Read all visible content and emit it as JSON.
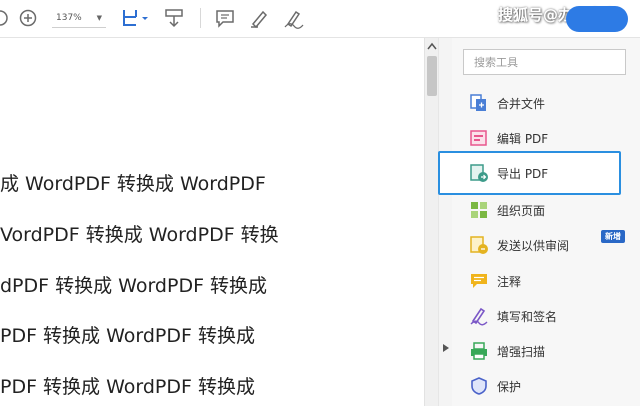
{
  "toolbar": {
    "zoom_value": "137%",
    "icons": [
      "zoom-in-icon",
      "fit-page-icon",
      "scroll-mode-icon",
      "comment-icon",
      "highlight-icon",
      "sign-icon"
    ],
    "watermark": "搜狐号@办公专家"
  },
  "document": {
    "lines": [
      "成 WordPDF 转换成 WordPDF",
      "VordPDF 转换成 WordPDF 转换",
      "dPDF 转换成 WordPDF 转换成",
      "PDF 转换成 WordPDF 转换成",
      "PDF 转换成 WordPDF 转换成"
    ]
  },
  "tools_pane": {
    "search_placeholder": "搜索工具",
    "items": [
      {
        "label": "合并文件",
        "icon": "combine-files-icon",
        "color": "#4a7fd6"
      },
      {
        "label": "编辑 PDF",
        "icon": "edit-pdf-icon",
        "color": "#e8568d"
      },
      {
        "label": "导出 PDF",
        "icon": "export-pdf-icon",
        "color": "#3d9b8a",
        "selected": true
      },
      {
        "label": "组织页面",
        "icon": "organize-pages-icon",
        "color": "#7bb843"
      },
      {
        "label": "发送以供审阅",
        "icon": "send-for-review-icon",
        "color": "#e4b321",
        "badge": "新增"
      },
      {
        "label": "注释",
        "icon": "comment-icon",
        "color": "#f0b41c"
      },
      {
        "label": "填写和签名",
        "icon": "fill-sign-icon",
        "color": "#7b58c7"
      },
      {
        "label": "增强扫描",
        "icon": "enhance-scan-icon",
        "color": "#38a858"
      },
      {
        "label": "保护",
        "icon": "protect-icon",
        "color": "#4a62c9"
      }
    ]
  }
}
